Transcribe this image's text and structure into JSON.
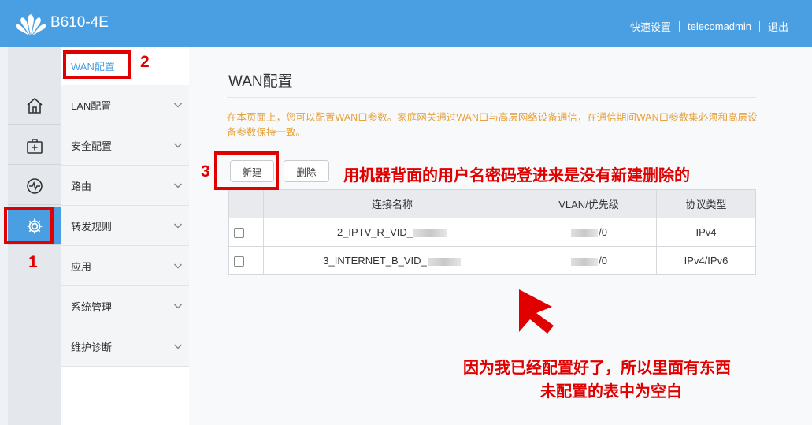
{
  "header": {
    "model": "B610-4E",
    "links": [
      "快速设置",
      "telecomadmin",
      "退出"
    ],
    "bg_color": "#4a9fe2"
  },
  "rail": {
    "items": [
      {
        "icon": "home-icon"
      },
      {
        "icon": "medical-kit-icon"
      },
      {
        "icon": "pulse-monitor-icon"
      },
      {
        "icon": "gear-icon",
        "active": true
      }
    ]
  },
  "submenu": {
    "active_label": "WAN配置",
    "items": [
      "LAN配置",
      "安全配置",
      "路由",
      "转发规则",
      "应用",
      "系统管理",
      "维护诊断"
    ]
  },
  "main": {
    "title": "WAN配置",
    "description": "在本页面上，您可以配置WAN口参数。家庭网关通过WAN口与高层网络设备通信，在通信期间WAN口参数集必须和高层设备参数保持一致。",
    "buttons": {
      "new": "新建",
      "delete": "删除"
    },
    "table": {
      "headers": [
        "连接名称",
        "VLAN/优先级",
        "协议类型"
      ],
      "rows": [
        {
          "name": "2_IPTV_R_VID_",
          "vlan": "/0",
          "protocol": "IPv4"
        },
        {
          "name": "3_INTERNET_B_VID_",
          "vlan": "/0",
          "protocol": "IPv4/IPv6"
        }
      ]
    }
  },
  "annotations": {
    "num1": "1",
    "num2": "2",
    "num3": "3",
    "text_top": "用机器背面的用户名密码登进来是没有新建删除的",
    "text_bottom_line1": "因为我已经配置好了，所以里面有东西",
    "text_bottom_line2": "未配置的表中为空白",
    "color": "#e00000"
  }
}
